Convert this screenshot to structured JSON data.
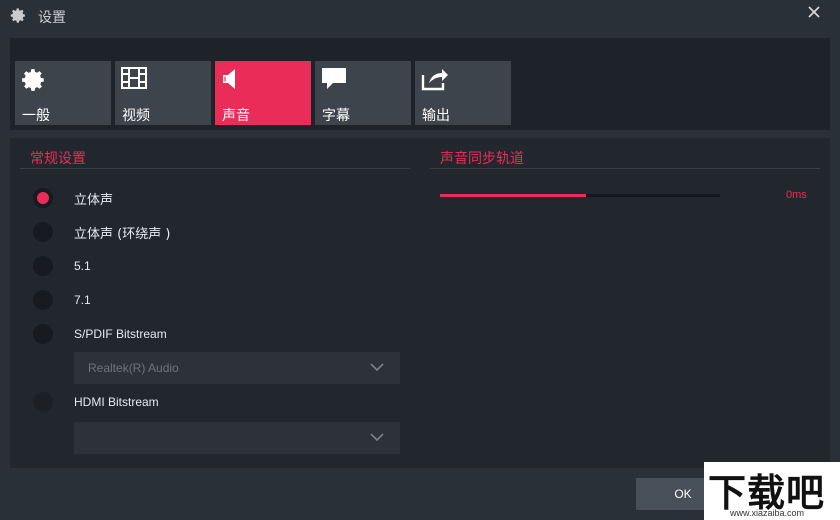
{
  "window": {
    "title": "设置",
    "title_icon": "gear-icon",
    "close_icon": "close-icon"
  },
  "tabs": [
    {
      "label": "一般",
      "icon": "gear-icon",
      "active": false
    },
    {
      "label": "视频",
      "icon": "film-icon",
      "active": false
    },
    {
      "label": "声音",
      "icon": "speaker-icon",
      "active": true
    },
    {
      "label": "字幕",
      "icon": "speech-bubble-icon",
      "active": false
    },
    {
      "label": "输出",
      "icon": "export-icon",
      "active": false
    }
  ],
  "general": {
    "title": "常规设置",
    "options": [
      {
        "label": "立体声",
        "selected": true
      },
      {
        "label": "立体声 (环绕声 )",
        "selected": false
      },
      {
        "label": "5.1",
        "selected": false
      },
      {
        "label": "7.1",
        "selected": false
      },
      {
        "label": "S/PDIF Bitstream",
        "selected": false
      },
      {
        "label": "HDMI Bitstream",
        "selected": false
      }
    ],
    "spdif_device": {
      "value": "Realtek(R) Audio"
    },
    "hdmi_device": {
      "value": ""
    }
  },
  "sync": {
    "title": "声音同步轨道",
    "value_label": "0ms",
    "fill_fraction": 0.52
  },
  "footer": {
    "ok_label": "OK"
  },
  "watermark": {
    "big_text": "下载吧",
    "small_text": "www.xiazaiba.com"
  },
  "colors": {
    "accent": "#ea2c59",
    "background": "#2a3038",
    "panel": "#22272d",
    "tab": "#3d444c"
  }
}
